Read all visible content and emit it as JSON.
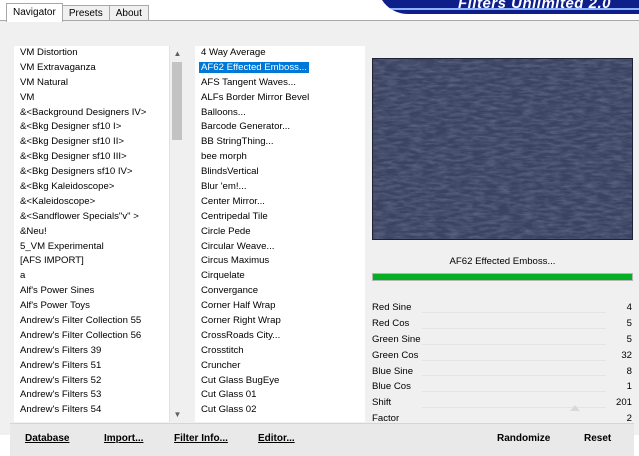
{
  "tabs": [
    {
      "label": "Navigator"
    },
    {
      "label": "Presets"
    },
    {
      "label": "About"
    }
  ],
  "brand": {
    "title": "Filters Unlimited 2.0"
  },
  "categories": [
    "VM Distortion",
    "VM Extravaganza",
    "VM Natural",
    "VM",
    "&<Background Designers IV>",
    "&<Bkg Designer sf10 I>",
    "&<Bkg Designer sf10 II>",
    "&<Bkg Designer sf10 III>",
    "&<Bkg Designers sf10 IV>",
    "&<Bkg Kaleidoscope>",
    "&<Kaleidoscope>",
    "&<Sandflower Specials\"v\" >",
    "&Neu!",
    "5_VM Experimental",
    "[AFS IMPORT]",
    "a",
    "Alf's Power Sines",
    "Alf's Power Toys",
    "Andrew's Filter Collection 55",
    "Andrew's Filter Collection 56",
    "Andrew's Filters 39",
    "Andrew's Filters 51",
    "Andrew's Filters 52",
    "Andrew's Filters 53",
    "Andrew's Filters 54"
  ],
  "filters": [
    "4 Way Average",
    "AF62 Effected Emboss...",
    "AFS Tangent Waves...",
    "ALFs Border Mirror Bevel",
    "Balloons...",
    "Barcode Generator...",
    "BB StringThing...",
    "bee morph",
    "BlindsVertical",
    "Blur 'em!...",
    "Center Mirror...",
    "Centripedal Tile",
    "Circle Pede",
    "Circular Weave...",
    "Circus Maximus",
    "Cirquelate",
    "Convergance",
    "Corner Half Wrap",
    "Corner Right Wrap",
    "CrossRoads City...",
    "Crosstitch",
    "Cruncher",
    "Cut Glass  BugEye",
    "Cut Glass 01",
    "Cut Glass 02"
  ],
  "selected_filter_index": 1,
  "selected_filter_name": "AF62 Effected Emboss...",
  "progress": 1.0,
  "params": [
    {
      "name": "Red Sine",
      "value": "4"
    },
    {
      "name": "Red Cos",
      "value": "5"
    },
    {
      "name": "Green Sine",
      "value": "5"
    },
    {
      "name": "Green Cos",
      "value": "32"
    },
    {
      "name": "Blue Sine",
      "value": "8"
    },
    {
      "name": "Blue Cos",
      "value": "1"
    },
    {
      "name": "Shift",
      "value": "201"
    },
    {
      "name": "Factor",
      "value": "2"
    }
  ],
  "buttons": {
    "database": "Database",
    "import": "Import...",
    "filter_info": "Filter Info...",
    "editor": "Editor...",
    "randomize": "Randomize",
    "reset": "Reset"
  },
  "icons": {
    "scroll_up": "chevron-up-icon",
    "scroll_down": "chevron-down-icon"
  },
  "colors": {
    "selection": "#0078d7",
    "preview": "#3b4463",
    "brand": "#0f1f8a",
    "progress": "#06b025"
  }
}
